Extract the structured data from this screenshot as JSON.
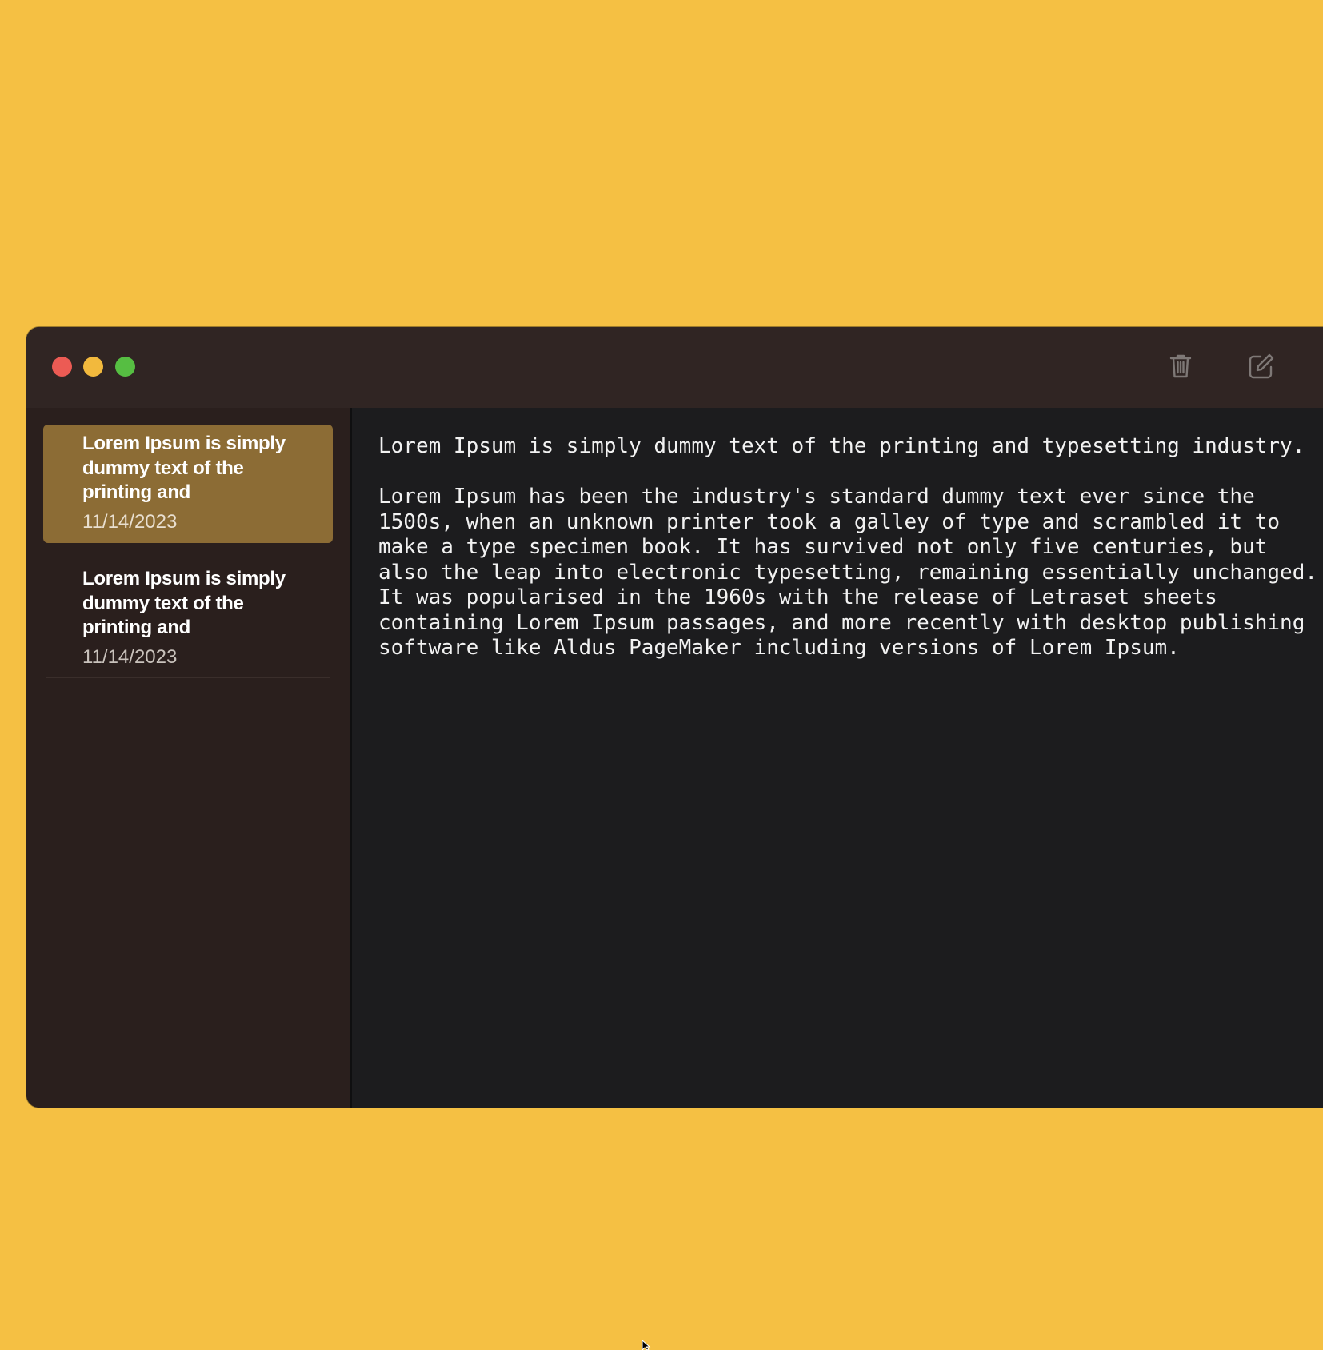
{
  "window": {
    "toolbar": {
      "trash_icon": "trash-icon",
      "compose_icon": "compose-icon"
    },
    "sidebar": {
      "notes": [
        {
          "title": "Lorem Ipsum is simply dummy text of the printing and",
          "date": "11/14/2023",
          "selected": true
        },
        {
          "title": "Lorem Ipsum is simply dummy text of the printing and",
          "date": "11/14/2023",
          "selected": false
        }
      ]
    },
    "editor": {
      "content": "Lorem Ipsum is simply dummy text of the printing and typesetting industry.\n\nLorem Ipsum has been the industry's standard dummy text ever since the 1500s, when an unknown printer took a galley of type and scrambled it to make a type specimen book. It has survived not only five centuries, but also the leap into electronic typesetting, remaining essentially unchanged. It was popularised in the 1960s with the release of Letraset sheets containing Lorem Ipsum passages, and more recently with desktop publishing software like Aldus PageMaker including versions of Lorem Ipsum."
    }
  },
  "colors": {
    "desktop_background": "#F5C043",
    "titlebar": "#302523",
    "sidebar": "#2A1F1D",
    "selected_note": "#8C6C35",
    "editor_background": "#1C1C1E",
    "close": "#EC5B54",
    "minimize": "#F2B93D",
    "zoom": "#56BE42"
  }
}
